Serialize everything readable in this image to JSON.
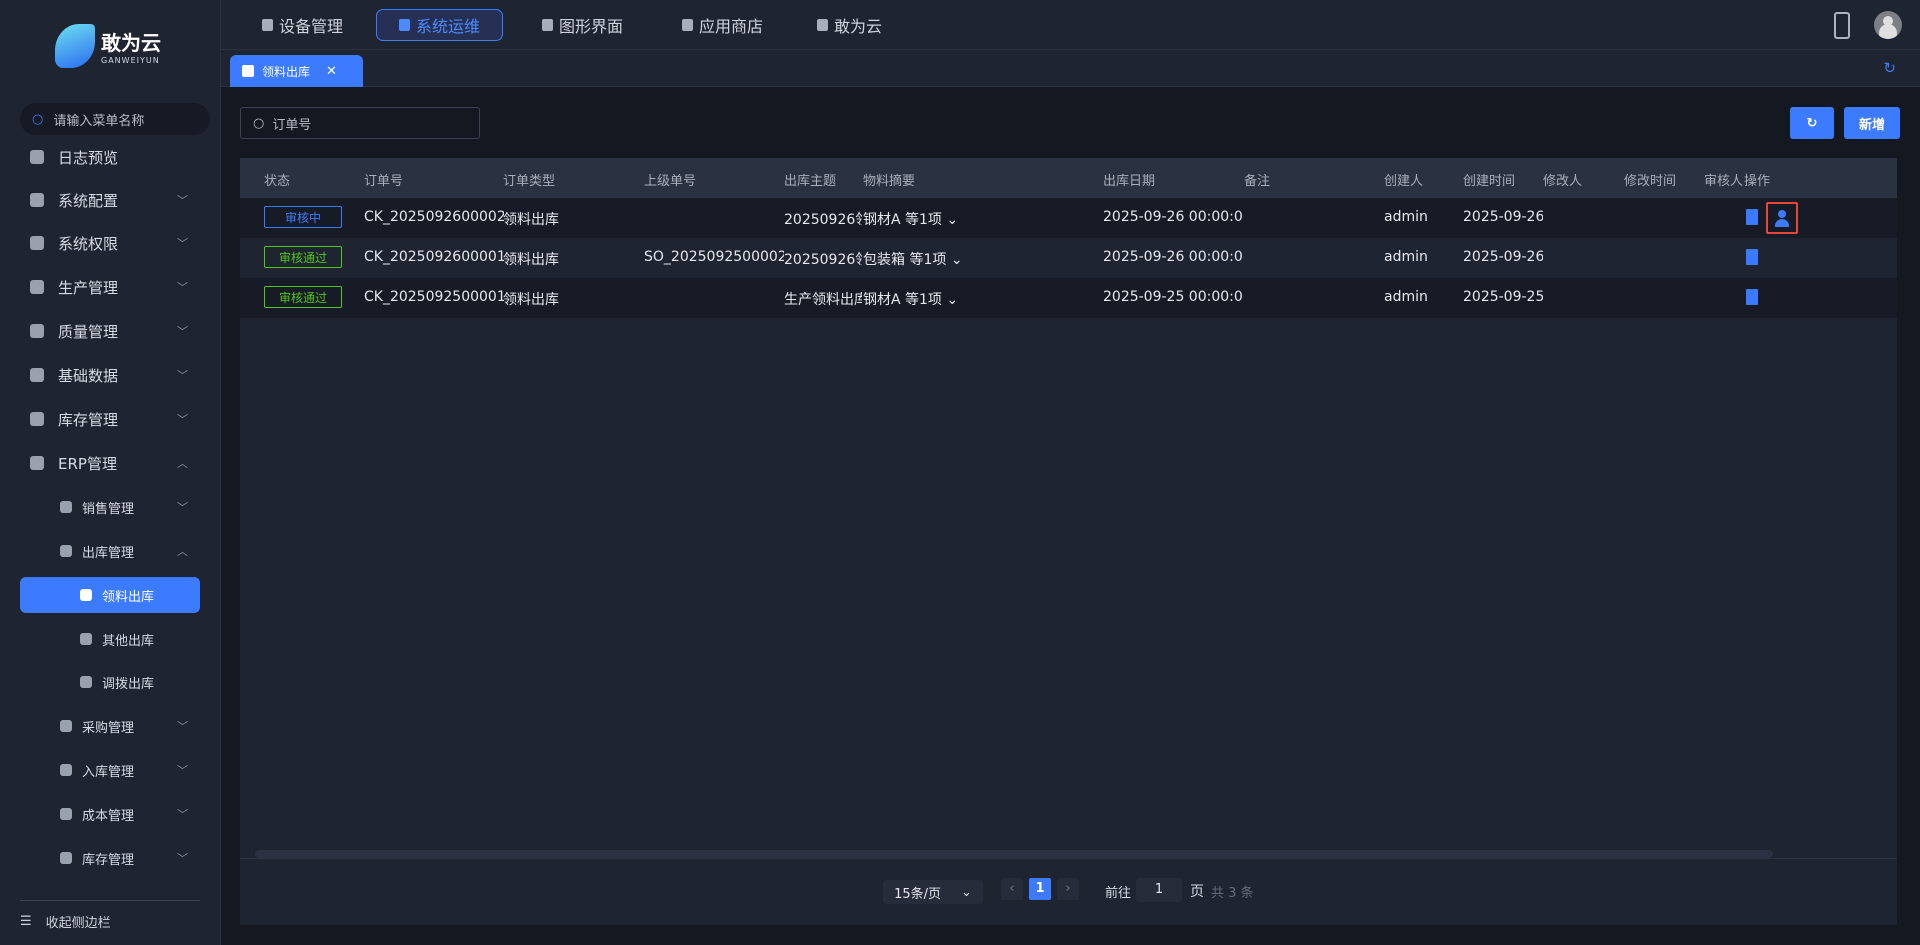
{
  "brand": {
    "name": "敢为云",
    "sub": "GANWEIYUN"
  },
  "sidebar": {
    "search_placeholder": "请输入菜单名称",
    "collapse": "收起侧边栏",
    "items": [
      {
        "label": "日志预览",
        "level": 0,
        "chev": ""
      },
      {
        "label": "系统配置",
        "level": 0,
        "chev": "﹀"
      },
      {
        "label": "系统权限",
        "level": 0,
        "chev": "﹀"
      },
      {
        "label": "生产管理",
        "level": 0,
        "chev": "﹀"
      },
      {
        "label": "质量管理",
        "level": 0,
        "chev": "﹀"
      },
      {
        "label": "基础数据",
        "level": 0,
        "chev": "﹀"
      },
      {
        "label": "库存管理",
        "level": 0,
        "chev": "﹀"
      },
      {
        "label": "ERP管理",
        "level": 0,
        "chev": "︿"
      },
      {
        "label": "销售管理",
        "level": 1,
        "chev": "﹀"
      },
      {
        "label": "出库管理",
        "level": 1,
        "chev": "︿"
      },
      {
        "label": "领料出库",
        "level": 2,
        "chev": "",
        "active": true
      },
      {
        "label": "其他出库",
        "level": 2,
        "chev": ""
      },
      {
        "label": "调拨出库",
        "level": 2,
        "chev": ""
      },
      {
        "label": "采购管理",
        "level": 1,
        "chev": "﹀"
      },
      {
        "label": "入库管理",
        "level": 1,
        "chev": "﹀"
      },
      {
        "label": "成本管理",
        "level": 1,
        "chev": "﹀"
      },
      {
        "label": "库存管理",
        "level": 1,
        "chev": "﹀"
      }
    ]
  },
  "topnav": [
    {
      "label": "设备管理"
    },
    {
      "label": "系统运维",
      "active": true
    },
    {
      "label": "图形界面"
    },
    {
      "label": "应用商店"
    },
    {
      "label": "敢为云"
    }
  ],
  "tabs": [
    {
      "label": "领料出库",
      "close": "✕"
    }
  ],
  "toolbar": {
    "search_placeholder": "订单号",
    "refresh_icon": "↻",
    "add_label": "新增"
  },
  "table": {
    "headers": [
      "状态",
      "订单号",
      "订单类型",
      "上级单号",
      "出库主题",
      "物料摘要",
      "出库日期",
      "备注",
      "创建人",
      "创建时间",
      "修改人",
      "修改时间",
      "审核人",
      "操作"
    ],
    "rows": [
      {
        "status": "审核中",
        "status_color": "#3c7bff",
        "order": "CK_2025092600002",
        "type": "领料出库",
        "parent": "",
        "subject": "20250926领料出库",
        "summary": "钢材A 等1项",
        "date": "2025-09-26 00:00:00",
        "remark": "",
        "creator": "admin",
        "created": "2025-09-26",
        "modifier": "",
        "modified": "",
        "auditor": "",
        "can_audit": true
      },
      {
        "status": "审核通过",
        "status_color": "#52c41a",
        "order": "CK_2025092600001",
        "type": "领料出库",
        "parent": "SO_2025092500002",
        "subject": "20250926领料出库",
        "summary": "包装箱 等1项",
        "date": "2025-09-26 00:00:00",
        "remark": "",
        "creator": "admin",
        "created": "2025-09-26",
        "modifier": "",
        "modified": "",
        "auditor": "",
        "can_audit": false
      },
      {
        "status": "审核通过",
        "status_color": "#52c41a",
        "order": "CK_2025092500001",
        "type": "领料出库",
        "parent": "",
        "subject": "生产领料出库",
        "summary": "钢材A 等1项",
        "date": "2025-09-25 00:00:00",
        "remark": "",
        "creator": "admin",
        "created": "2025-09-25",
        "modifier": "",
        "modified": "",
        "auditor": "",
        "can_audit": false
      }
    ]
  },
  "pagination": {
    "page_size": "15条/页",
    "current": "1",
    "goto_label": "前往",
    "goto_value": "1",
    "page_unit": "页",
    "total": "共 3 条"
  }
}
